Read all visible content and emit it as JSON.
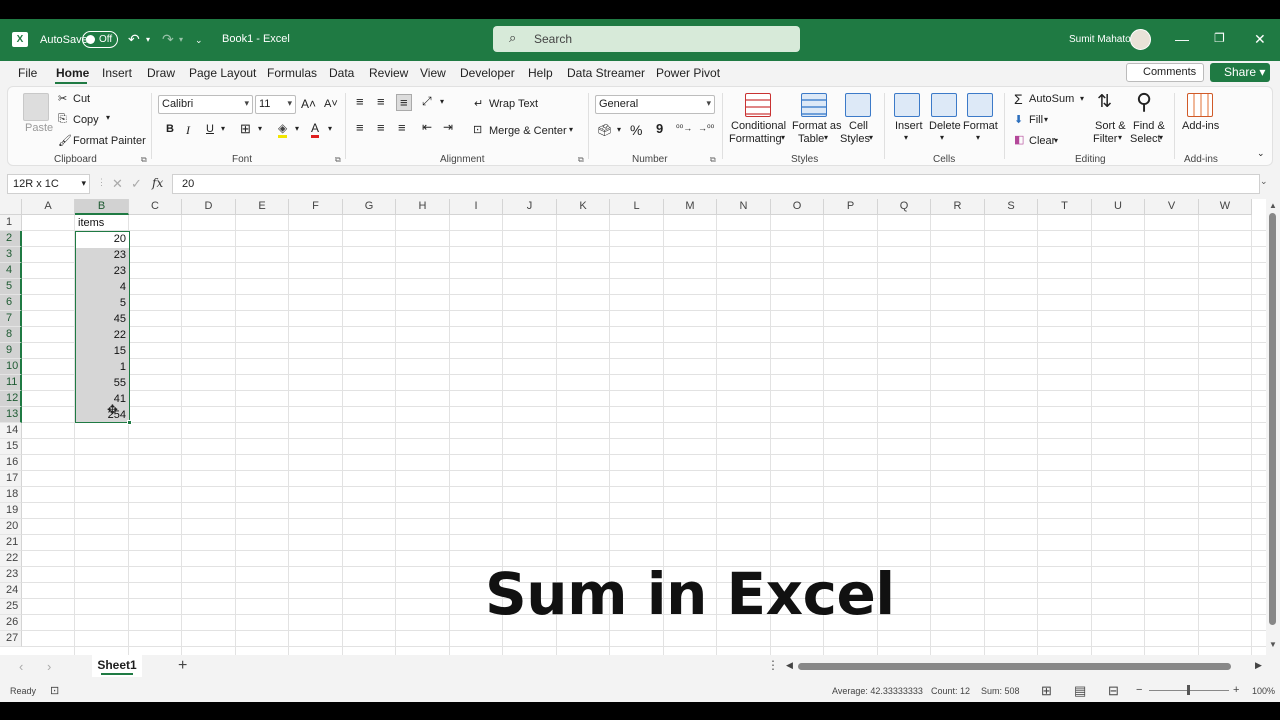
{
  "titlebar": {
    "autosave_label": "AutoSave",
    "autosave_state": "Off",
    "document_title": "Book1  -  Excel",
    "search_placeholder": "Search",
    "user_name": "Sumit Mahato",
    "accent_color": "#1f7a43"
  },
  "tabs": [
    "File",
    "Home",
    "Insert",
    "Draw",
    "Page Layout",
    "Formulas",
    "Data",
    "Review",
    "View",
    "Developer",
    "Help",
    "Data Streamer",
    "Power Pivot"
  ],
  "active_tab": "Home",
  "actions": {
    "comments": "Comments",
    "share": "Share"
  },
  "ribbon": {
    "clipboard": {
      "paste": "Paste",
      "cut": "Cut",
      "copy": "Copy",
      "format_painter": "Format Painter",
      "group": "Clipboard"
    },
    "font": {
      "name": "Calibri",
      "size": "11",
      "group": "Font",
      "bold": "B",
      "italic": "I",
      "underline": "U"
    },
    "alignment": {
      "wrap_text": "Wrap Text",
      "merge_center": "Merge & Center",
      "group": "Alignment"
    },
    "number": {
      "format": "General",
      "percent": "%",
      "comma": "9",
      "group": "Number"
    },
    "styles": {
      "conditional": "Conditional",
      "conditional2": "Formatting",
      "format_as": "Format as",
      "format_as2": "Table",
      "cell": "Cell",
      "cell2": "Styles",
      "group": "Styles"
    },
    "cells": {
      "insert": "Insert",
      "delete": "Delete",
      "format": "Format",
      "group": "Cells"
    },
    "editing": {
      "autosum": "AutoSum",
      "fill": "Fill",
      "clear": "Clear",
      "sort": "Sort &",
      "sort2": "Filter",
      "find": "Find &",
      "find2": "Select",
      "group": "Editing"
    },
    "addins": {
      "label": "Add-ins",
      "group": "Add-ins"
    }
  },
  "formula_bar": {
    "name_box": "12R x 1C",
    "fx": "fx",
    "value": "20"
  },
  "columns": [
    "A",
    "B",
    "C",
    "D",
    "E",
    "F",
    "G",
    "H",
    "I",
    "J",
    "K",
    "L",
    "M",
    "N",
    "O",
    "P",
    "Q",
    "R",
    "S",
    "T",
    "U",
    "V",
    "W"
  ],
  "rows": [
    "1",
    "2",
    "3",
    "4",
    "5",
    "6",
    "7",
    "8",
    "9",
    "10",
    "11",
    "12",
    "13",
    "14",
    "15",
    "16",
    "17",
    "18",
    "19",
    "20",
    "21",
    "22",
    "23",
    "24",
    "25",
    "26",
    "27"
  ],
  "sheet": {
    "header_cell": "items",
    "values": [
      "20",
      "23",
      "23",
      "4",
      "5",
      "45",
      "22",
      "15",
      "1",
      "55",
      "41",
      "254"
    ]
  },
  "overlay_title": "Sum in Excel",
  "sheet_tabs": {
    "active": "Sheet1"
  },
  "status": {
    "ready": "Ready",
    "average": "Average: 42.33333333",
    "count": "Count: 12",
    "sum": "Sum: 508",
    "zoom": "100%"
  }
}
